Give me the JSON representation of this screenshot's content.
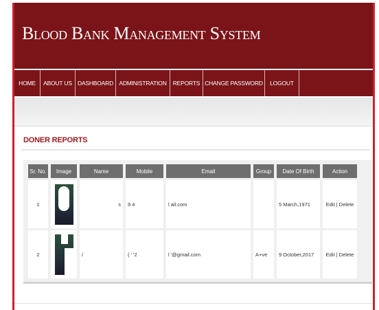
{
  "site": {
    "title": "Blood Bank Management System"
  },
  "nav": [
    {
      "label": "HOME"
    },
    {
      "label": "ABOUT US"
    },
    {
      "label": "DASHBOARD"
    },
    {
      "label": "ADMINISTRATION"
    },
    {
      "label": "REPORTS"
    },
    {
      "label": "CHANGE PASSWORD"
    },
    {
      "label": "LOGOUT"
    }
  ],
  "section": {
    "title": "DONER REPORTS"
  },
  "table": {
    "headers": [
      "Sr. No.",
      "Image",
      "Name",
      "Mobile",
      "Email",
      "Group",
      "Date Of Birth",
      "Action"
    ],
    "rows": [
      {
        "sr": "1",
        "name": "s",
        "mobile": "9        4",
        "email": "l            ail.com",
        "group": "",
        "dob": "5 March,1971",
        "action": "Edit | Delete"
      },
      {
        "sr": "2",
        "name": "/",
        "mobile": "(  '      '2",
        "email": "l               '@gmail.com",
        "group": "A+ve",
        "dob": "9 October,2017",
        "action": "Edit | Delete"
      }
    ]
  },
  "colors": {
    "header_bg": "#7a1418",
    "accent": "#9b1c22",
    "table_header": "#6e6e6e"
  }
}
